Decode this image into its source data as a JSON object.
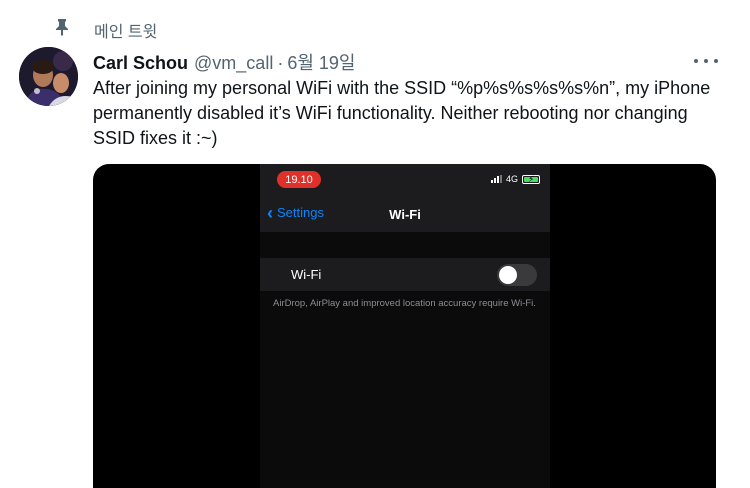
{
  "pinned": {
    "label": "메인 트윗",
    "icon": "pin-icon"
  },
  "tweet": {
    "author_name": "Carl Schou",
    "author_handle": "@vm_call",
    "separator": "·",
    "date": "6월 19일",
    "text": "After joining my personal WiFi with the SSID “%p%s%s%s%s%n”, my iPhone permanently disabled it’s WiFi functionality. Neither rebooting nor changing SSID fixes it :~)",
    "more_icon": "more-icon"
  },
  "media": {
    "status_time": "19.10",
    "network": "4G",
    "back_label": "Settings",
    "nav_title": "Wi-Fi",
    "wifi_row_label": "Wi-Fi",
    "wifi_toggle_on": false,
    "footnote": "AirDrop, AirPlay and improved location accuracy require Wi-Fi."
  },
  "colors": {
    "secondary_text": "#536471",
    "ios_blue": "#0a84ff",
    "time_pill_red": "#e0302a",
    "battery_green": "#4cd964"
  }
}
